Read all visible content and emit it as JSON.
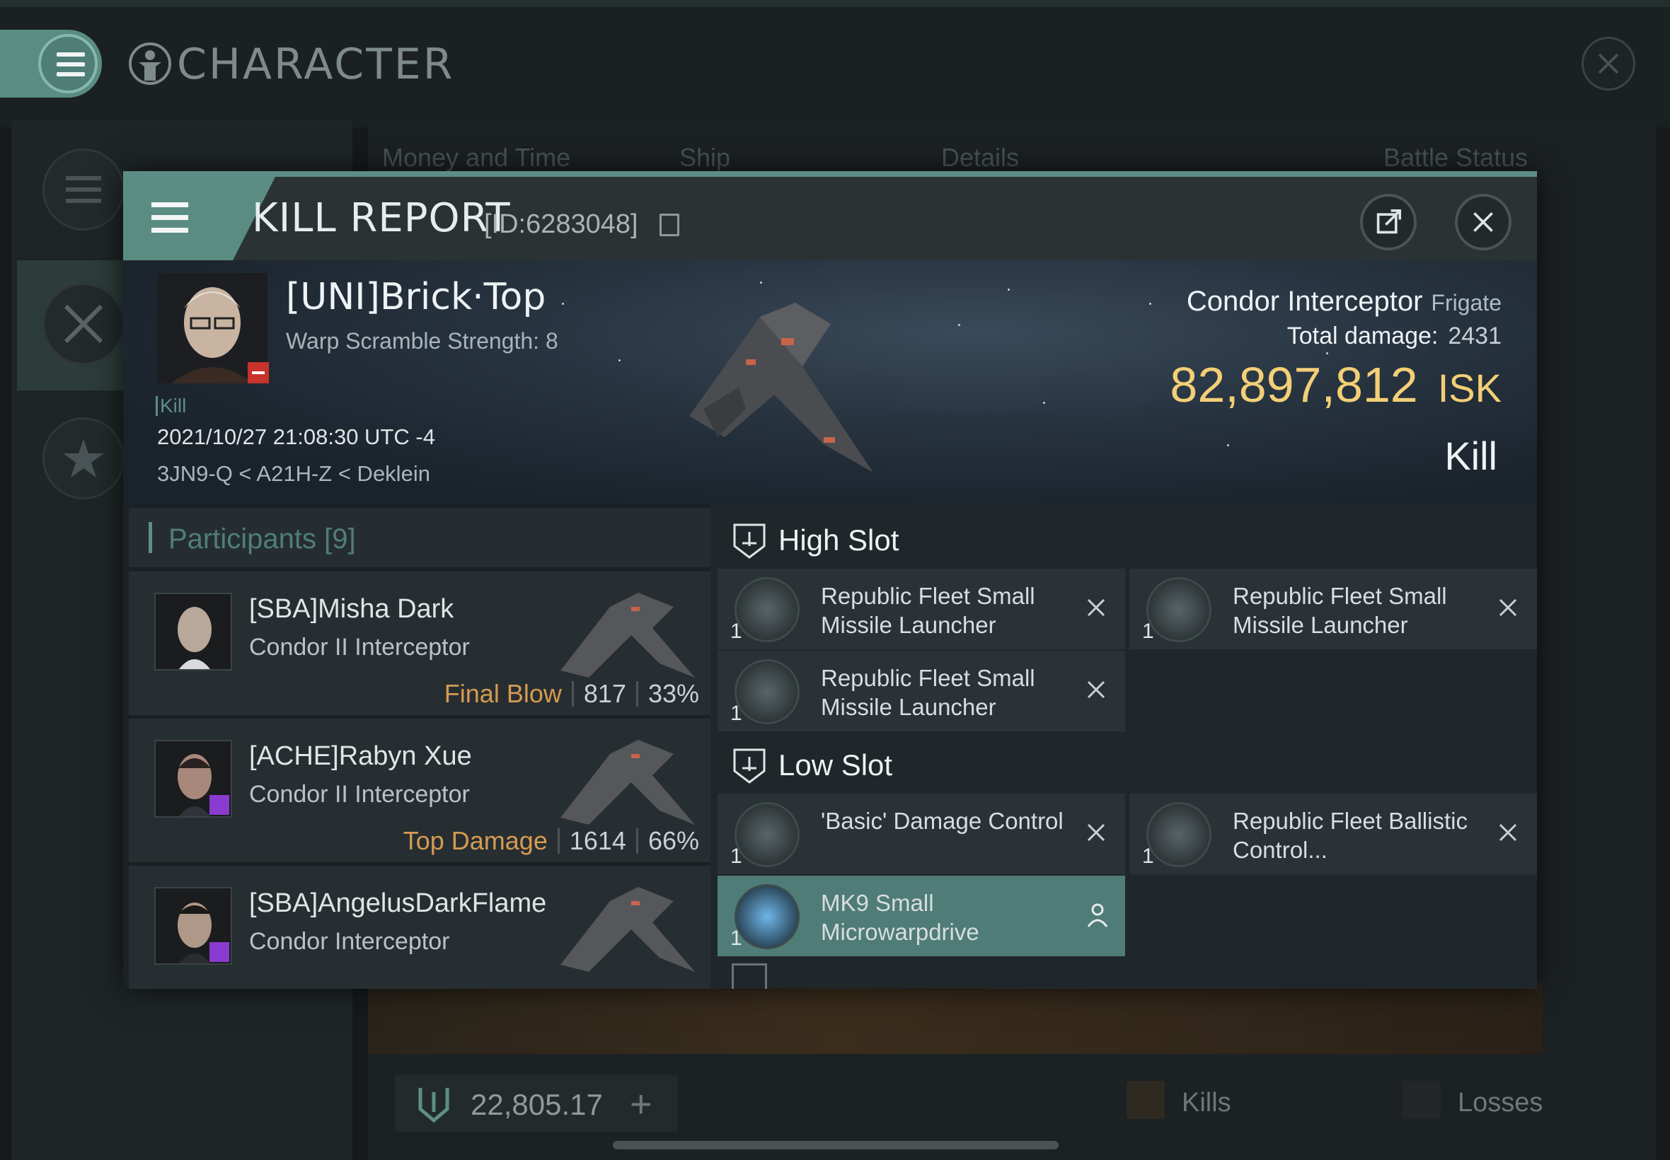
{
  "background": {
    "title": "CHARACTER",
    "tabs": [
      "Money and Time",
      "Ship",
      "Details",
      "Battle Status"
    ],
    "isk_balance": "22,805.17",
    "add_label": "+",
    "kills_label": "Kills",
    "losses_label": "Losses"
  },
  "modal": {
    "title": "KILL REPORT",
    "id_label": "[ID:6283048]",
    "victim": {
      "name": "[UNI]Brick·Top",
      "warp_scramble": "Warp Scramble Strength: 8",
      "tag": "Kill",
      "datetime": "2021/10/27 21:08:30 UTC -4",
      "location": "3JN9-Q < A21H-Z < Deklein"
    },
    "ship": {
      "name": "Condor Interceptor",
      "class": "Frigate",
      "total_damage_label": "Total damage:",
      "total_damage": "2431",
      "isk_value": "82,897,812",
      "isk_unit": "ISK",
      "result": "Kill"
    },
    "participants": {
      "title": "Participants [9]",
      "rows": [
        {
          "name": "[SBA]Misha Dark",
          "ship": "Condor II Interceptor",
          "label": "Final Blow",
          "damage": "817",
          "percent": "33%"
        },
        {
          "name": "[ACHE]Rabyn Xue",
          "ship": "Condor II Interceptor",
          "label": "Top Damage",
          "damage": "1614",
          "percent": "66%"
        },
        {
          "name": "[SBA]AngelusDarkFlame",
          "ship": "Condor Interceptor",
          "label": "",
          "damage": "",
          "percent": ""
        }
      ]
    },
    "slots": {
      "high_title": "High Slot",
      "high_items": [
        {
          "qty": "1",
          "name": "Republic Fleet Small Missile Launcher"
        },
        {
          "qty": "1",
          "name": "Republic Fleet Small Missile Launcher"
        },
        {
          "qty": "1",
          "name": "Republic Fleet Small Missile Launcher"
        }
      ],
      "low_title": "Low Slot",
      "low_items": [
        {
          "qty": "1",
          "name": "'Basic' Damage Control"
        },
        {
          "qty": "1",
          "name": "Republic Fleet Ballistic Control..."
        },
        {
          "qty": "1",
          "name": "MK9 Small Microwarpdrive"
        }
      ]
    }
  }
}
